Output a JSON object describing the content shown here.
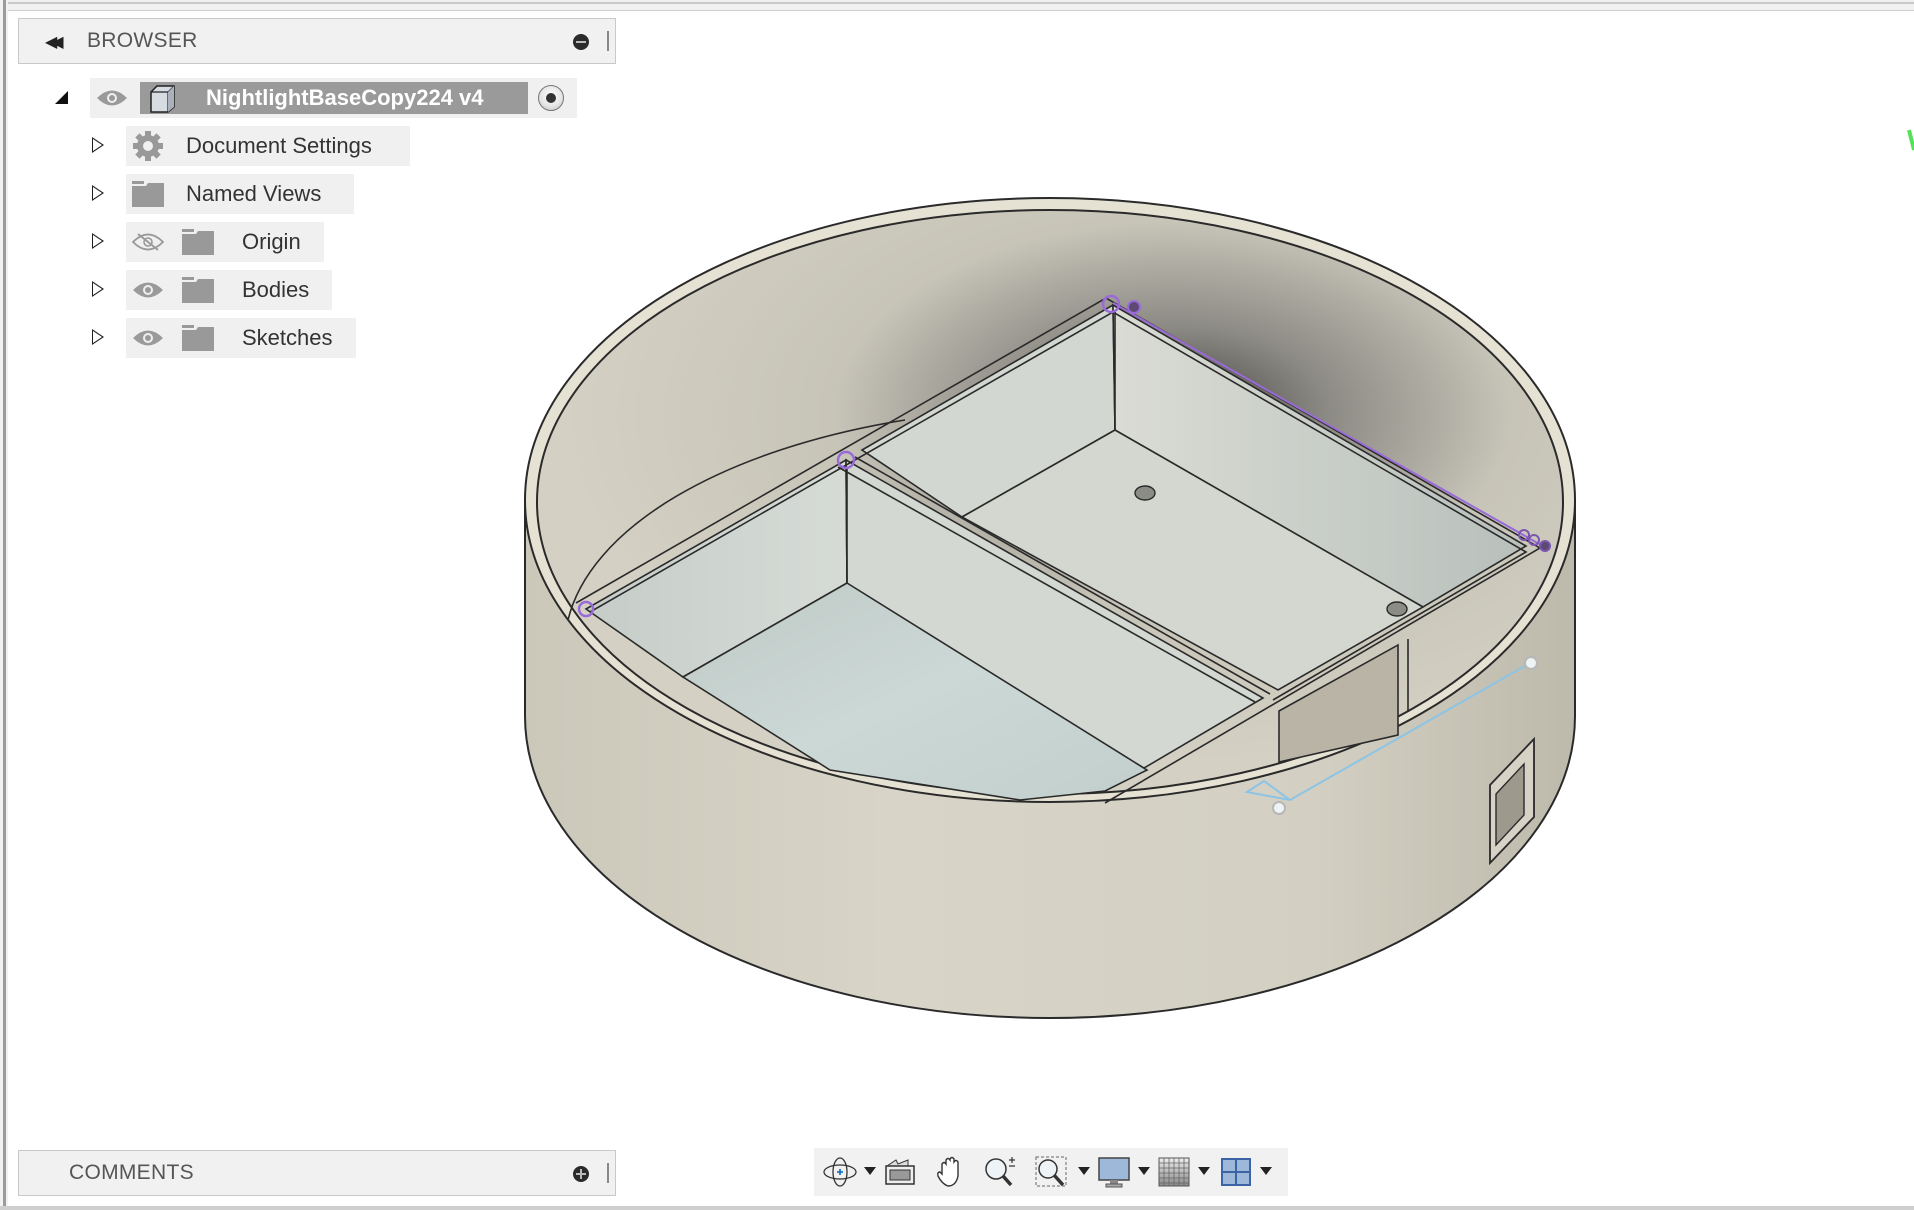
{
  "browser": {
    "title": "BROWSER",
    "collapse_icon": "double-left-arrow-icon",
    "minimize_icon": "minus-circle-icon",
    "root": {
      "label": "NightlightBaseCopy224 v4",
      "expanded": true,
      "visible": true,
      "icon": "component-icon",
      "active_radio": true
    },
    "items": [
      {
        "label": "Document Settings",
        "icon": "gear-icon",
        "visibility": null
      },
      {
        "label": "Named Views",
        "icon": "folder-icon",
        "visibility": null
      },
      {
        "label": "Origin",
        "icon": "folder-icon",
        "visibility": "hidden"
      },
      {
        "label": "Bodies",
        "icon": "folder-icon",
        "visibility": "visible"
      },
      {
        "label": "Sketches",
        "icon": "folder-icon",
        "visibility": "visible"
      }
    ]
  },
  "comments": {
    "title": "COMMENTS",
    "add_icon": "plus-circle-icon"
  },
  "nav_toolbar": {
    "items": [
      {
        "name": "orbit",
        "icon": "orbit-icon",
        "has_dropdown": true
      },
      {
        "name": "look-at",
        "icon": "look-at-icon",
        "has_dropdown": false
      },
      {
        "name": "pan",
        "icon": "hand-icon",
        "has_dropdown": false
      },
      {
        "name": "zoom",
        "icon": "zoom-icon",
        "has_dropdown": false
      },
      {
        "name": "fit",
        "icon": "zoom-window-icon",
        "has_dropdown": true
      },
      {
        "name": "display-settings",
        "icon": "monitor-icon",
        "has_dropdown": true
      },
      {
        "name": "grid-and-snaps",
        "icon": "grid-icon",
        "has_dropdown": true
      },
      {
        "name": "viewports",
        "icon": "viewports-icon",
        "has_dropdown": true
      }
    ]
  },
  "model": {
    "name": "NightlightBaseCopy224 v4",
    "colors": {
      "body": "#d6d3c6",
      "inner": "#cfd3cc",
      "floor": "#c9d6d4",
      "edge": "#2a2a2a",
      "sketch_constraint": "#9a6bd8",
      "sketch_line": "#8cc4e6",
      "axis_indicator": "#59e05a"
    }
  }
}
